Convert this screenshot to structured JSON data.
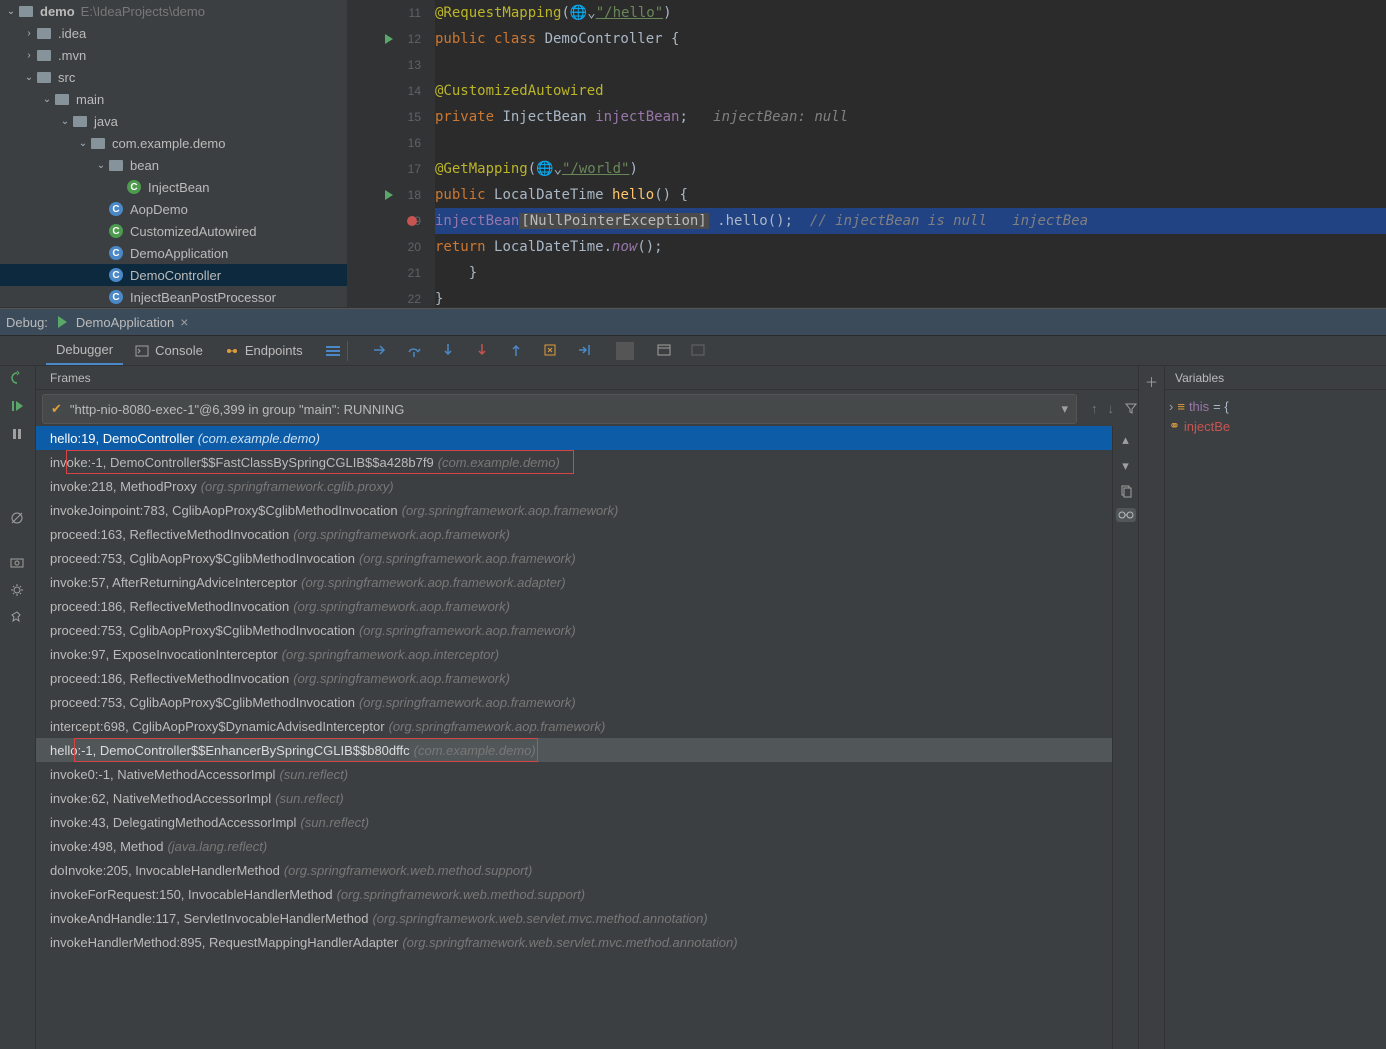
{
  "project": {
    "root": {
      "name": "demo",
      "path": "E:\\IdeaProjects\\demo"
    },
    "nodes": [
      {
        "indent": 1,
        "chev": "›",
        "icon": "folder",
        "label": ".idea"
      },
      {
        "indent": 1,
        "chev": "›",
        "icon": "folder",
        "label": ".mvn"
      },
      {
        "indent": 1,
        "chev": "⌄",
        "icon": "folder",
        "label": "src"
      },
      {
        "indent": 2,
        "chev": "⌄",
        "icon": "folder",
        "label": "main"
      },
      {
        "indent": 3,
        "chev": "⌄",
        "icon": "folder",
        "label": "java"
      },
      {
        "indent": 4,
        "chev": "⌄",
        "icon": "folder",
        "label": "com.example.demo"
      },
      {
        "indent": 5,
        "chev": "⌄",
        "icon": "folder",
        "label": "bean"
      },
      {
        "indent": 6,
        "icon": "c-green",
        "label": "InjectBean"
      },
      {
        "indent": 5,
        "icon": "c-blue",
        "label": "AopDemo"
      },
      {
        "indent": 5,
        "icon": "c-green2",
        "label": "CustomizedAutowired"
      },
      {
        "indent": 5,
        "icon": "c-blue",
        "label": "DemoApplication"
      },
      {
        "indent": 5,
        "icon": "c-blue",
        "label": "DemoController",
        "selected": true
      },
      {
        "indent": 5,
        "icon": "c-blue",
        "label": "InjectBeanPostProcessor"
      }
    ]
  },
  "editor": {
    "lines": [
      {
        "n": 11,
        "html": "<span class='ann'>@RequestMapping</span>(🌐⌄<span class='str'>\"/hello\"</span>)"
      },
      {
        "n": 12,
        "mark": "run",
        "html": "<span class='kw'>public class </span><span class='cls'>DemoController</span> {"
      },
      {
        "n": 13,
        "html": ""
      },
      {
        "n": 14,
        "html": "    <span class='ann'>@CustomizedAutowired</span>"
      },
      {
        "n": 15,
        "html": "    <span class='kw'>private </span><span class='cls'>InjectBean </span><span class='fld'>injectBean</span>;   <span class='cmt'>injectBean: null</span>"
      },
      {
        "n": 16,
        "html": ""
      },
      {
        "n": 17,
        "html": "    <span class='ann'>@GetMapping</span>(🌐⌄<span class='str'>\"/world\"</span>)"
      },
      {
        "n": 18,
        "mark": "run2",
        "html": "    <span class='kw'>public </span><span class='cls'>LocalDateTime </span><span class='mtd'>hello</span>() {"
      },
      {
        "n": 19,
        "mark": "bp",
        "hl": true,
        "html": "        <span class='fld'>injectBean</span> <span class='npe'>[NullPointerException]</span> .hello();  <span class='cmt'>// injectBean is null   </span><span class='cmt'>injectBea</span>"
      },
      {
        "n": 20,
        "html": "        <span class='kw'>return </span><span class='cls'>LocalDateTime</span>.<span class='fld' style='font-style:italic'>now</span>();"
      },
      {
        "n": 21,
        "html": "    }"
      },
      {
        "n": 22,
        "html": "}"
      }
    ]
  },
  "debug": {
    "label": "Debug:",
    "run_name": "DemoApplication"
  },
  "dbg_tabs": {
    "debugger": "Debugger",
    "console": "Console",
    "endpoints": "Endpoints"
  },
  "frames": {
    "title": "Frames",
    "thread": "\"http-nio-8080-exec-1\"@6,399 in group \"main\": RUNNING",
    "stack": [
      {
        "main": "hello:19, DemoController",
        "pkg": "(com.example.demo)",
        "sel": true
      },
      {
        "main": "invoke:-1, DemoController$$FastClassBySpringCGLIB$$a428b7f9",
        "pkg": "(com.example.demo)"
      },
      {
        "main": "invoke:218, MethodProxy",
        "pkg": "(org.springframework.cglib.proxy)"
      },
      {
        "main": "invokeJoinpoint:783, CglibAopProxy$CglibMethodInvocation",
        "pkg": "(org.springframework.aop.framework)"
      },
      {
        "main": "proceed:163, ReflectiveMethodInvocation",
        "pkg": "(org.springframework.aop.framework)"
      },
      {
        "main": "proceed:753, CglibAopProxy$CglibMethodInvocation",
        "pkg": "(org.springframework.aop.framework)"
      },
      {
        "main": "invoke:57, AfterReturningAdviceInterceptor",
        "pkg": "(org.springframework.aop.framework.adapter)"
      },
      {
        "main": "proceed:186, ReflectiveMethodInvocation",
        "pkg": "(org.springframework.aop.framework)"
      },
      {
        "main": "proceed:753, CglibAopProxy$CglibMethodInvocation",
        "pkg": "(org.springframework.aop.framework)"
      },
      {
        "main": "invoke:97, ExposeInvocationInterceptor",
        "pkg": "(org.springframework.aop.interceptor)"
      },
      {
        "main": "proceed:186, ReflectiveMethodInvocation",
        "pkg": "(org.springframework.aop.framework)"
      },
      {
        "main": "proceed:753, CglibAopProxy$CglibMethodInvocation",
        "pkg": "(org.springframework.aop.framework)"
      },
      {
        "main": "intercept:698, CglibAopProxy$DynamicAdvisedInterceptor",
        "pkg": "(org.springframework.aop.framework)"
      },
      {
        "main": "hello:-1, DemoController$$EnhancerBySpringCGLIB$$b80dffc",
        "pkg": "(com.example.demo)",
        "hi": true
      },
      {
        "main": "invoke0:-1, NativeMethodAccessorImpl",
        "pkg": "(sun.reflect)"
      },
      {
        "main": "invoke:62, NativeMethodAccessorImpl",
        "pkg": "(sun.reflect)"
      },
      {
        "main": "invoke:43, DelegatingMethodAccessorImpl",
        "pkg": "(sun.reflect)"
      },
      {
        "main": "invoke:498, Method",
        "pkg": "(java.lang.reflect)"
      },
      {
        "main": "doInvoke:205, InvocableHandlerMethod",
        "pkg": "(org.springframework.web.method.support)"
      },
      {
        "main": "invokeForRequest:150, InvocableHandlerMethod",
        "pkg": "(org.springframework.web.method.support)"
      },
      {
        "main": "invokeAndHandle:117, ServletInvocableHandlerMethod",
        "pkg": "(org.springframework.web.servlet.mvc.method.annotation)"
      },
      {
        "main": "invokeHandlerMethod:895, RequestMappingHandlerAdapter",
        "pkg": "(org.springframework.web.servlet.mvc.method.annotation)"
      }
    ]
  },
  "variables": {
    "title": "Variables",
    "rows": [
      {
        "icon": "obj",
        "label": "this",
        "suffix": " = {"
      },
      {
        "icon": "link",
        "label": "injectBe"
      }
    ]
  }
}
